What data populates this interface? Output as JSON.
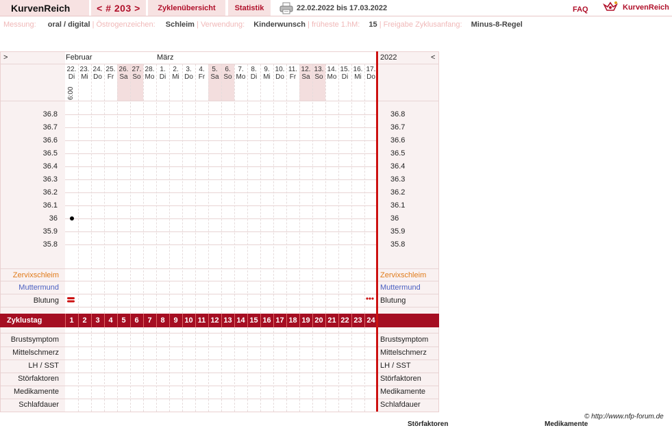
{
  "nav": {
    "brand": "KurvenReich",
    "cycle": "< # 203 >",
    "overview": "Zyklenübersicht",
    "stats": "Statistik",
    "range": "22.02.2022 bis 17.03.2022",
    "faq": "FAQ",
    "logo": "KurvenReich"
  },
  "info": [
    {
      "label": "Messung:",
      "value": "oral / digital"
    },
    {
      "label": "Östrogenzeichen:",
      "value": "Schleim"
    },
    {
      "label": "Verwendung:",
      "value": "Kinderwunsch"
    },
    {
      "label": "früheste 1.hM:",
      "value": "15"
    },
    {
      "label": "Freigabe Zyklusanfang:",
      "value": "Minus-8-Regel"
    }
  ],
  "chart": {
    "nav_left": ">",
    "nav_right": "<",
    "year": "2022",
    "months": [
      "Februar",
      "März"
    ],
    "days": [
      {
        "d": "22.",
        "w": "Di"
      },
      {
        "d": "23.",
        "w": "Mi"
      },
      {
        "d": "24.",
        "w": "Do"
      },
      {
        "d": "25.",
        "w": "Fr"
      },
      {
        "d": "26.",
        "w": "Sa"
      },
      {
        "d": "27.",
        "w": "So"
      },
      {
        "d": "28.",
        "w": "Mo"
      },
      {
        "d": "1.",
        "w": "Di"
      },
      {
        "d": "2.",
        "w": "Mi"
      },
      {
        "d": "3.",
        "w": "Do"
      },
      {
        "d": "4.",
        "w": "Fr"
      },
      {
        "d": "5.",
        "w": "Sa"
      },
      {
        "d": "6.",
        "w": "So"
      },
      {
        "d": "7.",
        "w": "Mo"
      },
      {
        "d": "8.",
        "w": "Di"
      },
      {
        "d": "9.",
        "w": "Mi"
      },
      {
        "d": "10.",
        "w": "Do"
      },
      {
        "d": "11.",
        "w": "Fr"
      },
      {
        "d": "12.",
        "w": "Sa"
      },
      {
        "d": "13.",
        "w": "So"
      },
      {
        "d": "14.",
        "w": "Mo"
      },
      {
        "d": "15.",
        "w": "Di"
      },
      {
        "d": "16.",
        "w": "Mi"
      },
      {
        "d": "17.",
        "w": "Do"
      }
    ],
    "time": "6:00",
    "temps": [
      "36.8",
      "36.7",
      "36.6",
      "36.5",
      "36.4",
      "36.3",
      "36.2",
      "36.1",
      "36",
      "35.9",
      "35.8"
    ],
    "temp_values": [
      {
        "day": 1,
        "value": 36.0
      }
    ],
    "rows_top": [
      {
        "label": "Zervixschleim",
        "color": "#e07b1a"
      },
      {
        "label": "Muttermund",
        "color": "#4a5fc1"
      },
      {
        "label": "Blutung",
        "color": "#222222"
      }
    ],
    "cycle_day_label": "Zyklustag",
    "cycle_days": [
      "1",
      "2",
      "3",
      "4",
      "5",
      "6",
      "7",
      "8",
      "9",
      "10",
      "11",
      "12",
      "13",
      "14",
      "15",
      "16",
      "17",
      "18",
      "19",
      "20",
      "21",
      "22",
      "23",
      "24"
    ],
    "rows_bottom": [
      "Brustsymptom",
      "Mittelschmerz",
      "LH / SST",
      "Störfaktoren",
      "Medikamente",
      "Schlafdauer"
    ]
  },
  "footer": {
    "copyright": "© http://www.nfp-forum.de",
    "legend_a": "Störfaktoren",
    "legend_b": "Medikamente"
  },
  "colors": {
    "accent": "#b0102a",
    "cycle_bar": "#a50e22",
    "divider": "#cc1111"
  }
}
